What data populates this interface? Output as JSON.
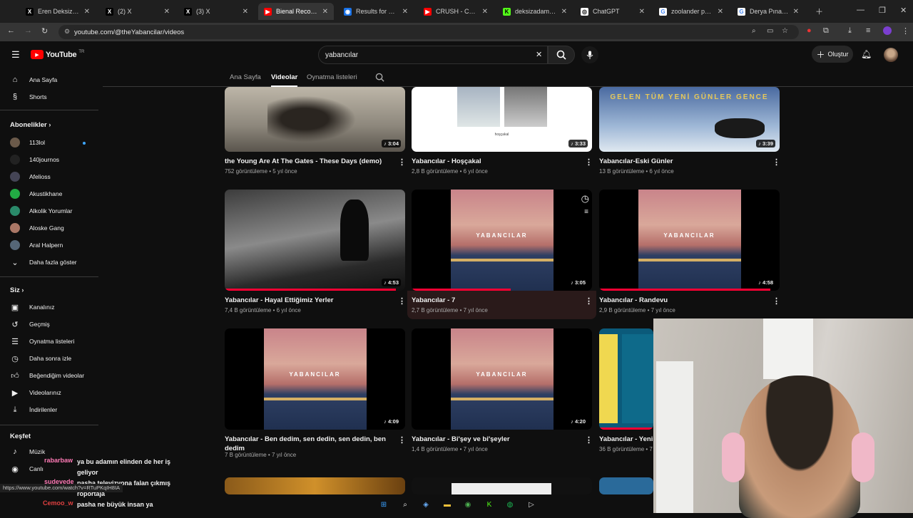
{
  "browser": {
    "tabs": [
      {
        "title": "Eren Deksiz (@de",
        "icon": "X"
      },
      {
        "title": "(2) X",
        "icon": "X"
      },
      {
        "title": "(3) X",
        "icon": "X"
      },
      {
        "title": "Bienal Records - Y",
        "icon": "▶"
      },
      {
        "title": "Results for quiz ld",
        "icon": "◉"
      },
      {
        "title": "CRUSH - CRUSH!",
        "icon": "▶"
      },
      {
        "title": "deksizadam Strea",
        "icon": "K"
      },
      {
        "title": "ChatGPT",
        "icon": "◎"
      },
      {
        "title": "zoolander pose - (",
        "icon": "G"
      },
      {
        "title": "Derya Pınar Ak - G",
        "icon": "G"
      }
    ],
    "url": "youtube.com/@theYabancilar/videos",
    "status_url": "https://www.youtube.com/watch?v=RTuPKqIH8IA"
  },
  "youtube": {
    "logo": "YouTube",
    "logo_sup": "TR",
    "search_value": "yabancılar",
    "create_label": "Oluştur"
  },
  "sidebar": {
    "top": [
      {
        "label": "Ana Sayfa",
        "icon": "home-icon"
      },
      {
        "label": "Shorts",
        "icon": "shorts-icon"
      }
    ],
    "subs_header": "Abonelikler",
    "subs": [
      {
        "label": "113lol",
        "color": "#6b5a4a"
      },
      {
        "label": "140journos",
        "color": "#222"
      },
      {
        "label": "Afelioss",
        "color": "#445"
      },
      {
        "label": "Akustikhane",
        "color": "#2a4"
      },
      {
        "label": "Alkolik Yorumlar",
        "color": "#2a8a6a"
      },
      {
        "label": "Aloske Gang",
        "color": "#a76"
      },
      {
        "label": "Aral Halpern",
        "color": "#567"
      }
    ],
    "more": "Daha fazla göster",
    "you_header": "Siz",
    "you": [
      {
        "label": "Kanalınız",
        "icon": "account-icon"
      },
      {
        "label": "Geçmiş",
        "icon": "history-icon"
      },
      {
        "label": "Oynatma listeleri",
        "icon": "playlist-icon"
      },
      {
        "label": "Daha sonra izle",
        "icon": "watch-later-icon"
      },
      {
        "label": "Beğendiğim videolar",
        "icon": "like-icon"
      },
      {
        "label": "Videolarınız",
        "icon": "your-videos-icon"
      },
      {
        "label": "İndirilenler",
        "icon": "download-icon"
      }
    ],
    "explore_header": "Keşfet",
    "explore": [
      {
        "label": "Müzik",
        "icon": "music-icon"
      },
      {
        "label": "Canlı",
        "icon": "live-icon"
      }
    ]
  },
  "channel_tabs": [
    "Ana Sayfa",
    "Videolar",
    "Oynatma listeleri"
  ],
  "videos": [
    {
      "title": "the Young Are At The Gates - These Days (demo)",
      "meta": "752 görüntüleme • 5 yıl önce",
      "duration": "3:04"
    },
    {
      "title": "Yabancılar - Hoşçakal",
      "meta": "2,8 B görüntüleme • 6 yıl önce",
      "duration": "3:33"
    },
    {
      "title": "Yabancılar-Eski Günler",
      "meta": "13 B görüntüleme • 6 yıl önce",
      "duration": "3:39"
    },
    {
      "title": "Yabancılar - Hayal Ettiğimiz Yerler",
      "meta": "7,4 B görüntüleme • 6 yıl önce",
      "duration": "4:53"
    },
    {
      "title": "Yabancılar - 7",
      "meta": "2,7 B görüntüleme • 7 yıl önce",
      "duration": "3:05"
    },
    {
      "title": "Yabancılar -  Randevu",
      "meta": "2,9 B görüntüleme • 7 yıl önce",
      "duration": "4:58"
    },
    {
      "title": "Yabancılar - Ben dedim, sen dedin, sen dedin, ben dedim",
      "meta": "7 B görüntüleme • 7 yıl önce",
      "duration": "4:09"
    },
    {
      "title": "Yabancılar - Bi'şey ve bi'şeyler",
      "meta": "1,4 B görüntüleme • 7 yıl önce",
      "duration": "4:20"
    },
    {
      "title": "Yabancılar - Yeni G",
      "meta": "36 B görüntüleme • 7",
      "duration": ""
    }
  ],
  "thumb_text": {
    "yabancilar": "YABANCILAR",
    "eski": "GELEN TÜM YENİ GÜNLER GENCE",
    "hoscakal": "hoşçakal"
  },
  "chat": [
    {
      "user": "rabarbaw",
      "color": "#ff7ab6",
      "text": "ya bu adamın elinden de her iş geliyor"
    },
    {
      "user": "sudevede",
      "color": "#ff7ab6",
      "text": "pasha televizyona falan çıkmış röportaja"
    },
    {
      "user": "Cemoo_w",
      "color": "#e04040",
      "text": "pasha ne büyük insan ya"
    }
  ]
}
